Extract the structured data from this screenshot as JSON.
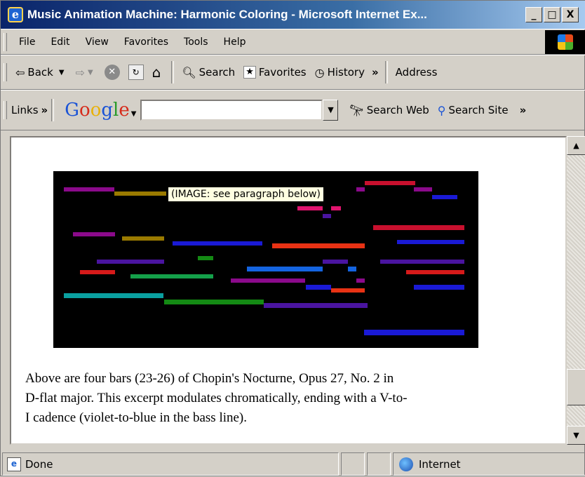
{
  "window": {
    "title": "Music Animation Machine: Harmonic Coloring - Microsoft Internet Ex...",
    "controls": {
      "minimize": "_",
      "maximize": "□",
      "close": "X"
    }
  },
  "menu": [
    "File",
    "Edit",
    "View",
    "Favorites",
    "Tools",
    "Help"
  ],
  "toolbar": {
    "back": "Back",
    "search": "Search",
    "favorites": "Favorites",
    "history": "History",
    "chevron": "»",
    "address": "Address"
  },
  "links_bar": {
    "links": "Links",
    "chevron": "»",
    "google": {
      "g1": "G",
      "o1": "o",
      "o2": "o",
      "g2": "g",
      "l": "l",
      "e": "e"
    },
    "search_web": "Search Web",
    "search_site": "Search Site"
  },
  "content": {
    "tooltip": "(IMAGE: see paragraph below)",
    "paragraph_lines": [
      "Above are four bars (23-26) of Chopin's Nocturne, Opus 27, No. 2 in",
      "D-flat major. This excerpt modulates chromatically, ending with a V-to-",
      "I cadence (violet-to-blue in the bass line)."
    ]
  },
  "status": {
    "text": "Done",
    "zone": "Internet"
  },
  "colors": {
    "title_bar": "#0a246a",
    "music_background": "#000000",
    "note_colors": [
      "#8b0a8b",
      "#9a7a00",
      "#1a1ad6",
      "#d61a1a",
      "#e0146e",
      "#4a14a0",
      "#14a04a",
      "#0aa0a0",
      "#148a14",
      "#e83214",
      "#1464e0"
    ]
  }
}
